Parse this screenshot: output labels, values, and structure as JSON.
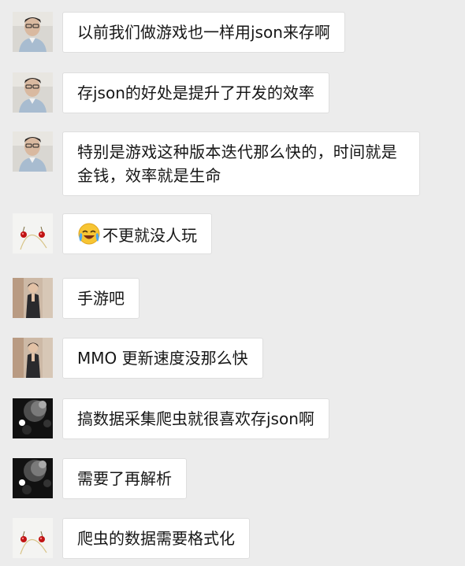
{
  "messages": [
    {
      "sender": "man",
      "text": "以前我们做游戏也一样用json来存啊"
    },
    {
      "sender": "man",
      "text": "存json的好处是提升了开发的效率"
    },
    {
      "sender": "man",
      "text": "特别是游戏这种版本迭代那么快的，时间就是金钱，效率就是生命"
    },
    {
      "sender": "cherries",
      "emoji": "laughing-crying-emoji",
      "text": "不更就没人玩"
    },
    {
      "sender": "woman",
      "text": "手游吧"
    },
    {
      "sender": "woman",
      "text": "MMO 更新速度没那么快"
    },
    {
      "sender": "moon",
      "text": "搞数据采集爬虫就很喜欢存json啊"
    },
    {
      "sender": "moon",
      "text": "需要了再解析"
    },
    {
      "sender": "cherries",
      "text": "爬虫的数据需要格式化"
    }
  ]
}
